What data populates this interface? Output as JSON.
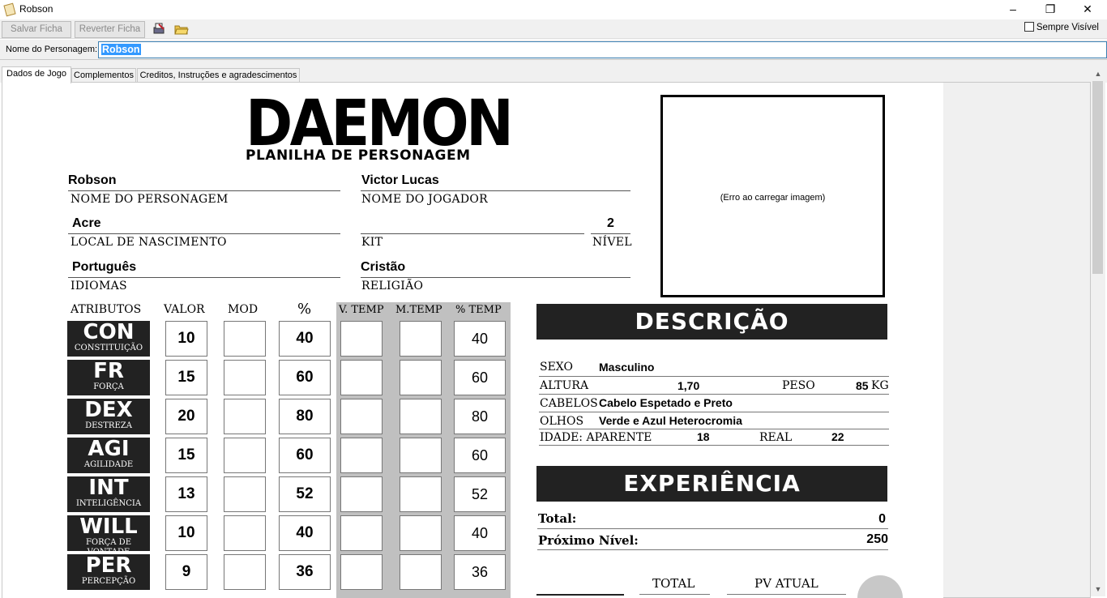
{
  "window": {
    "title": "Robson",
    "minimize": "–",
    "restore": "❐",
    "close": "✕"
  },
  "toolbar": {
    "save_label": "Salvar Ficha",
    "revert_label": "Reverter Ficha",
    "always_visible_label": "Sempre Visível"
  },
  "name_bar": {
    "label": "Nome do Personagem:",
    "value": "Robson"
  },
  "tabs": [
    {
      "label": "Dados de Jogo"
    },
    {
      "label": "Complementos"
    },
    {
      "label": "Creditos, Instruções e agradescimentos"
    }
  ],
  "sheet": {
    "logo": "DAEMON",
    "logo_sub": "PLANILHA DE PERSONAGEM",
    "character_name": {
      "value": "Robson",
      "label": "NOME DO PERSONAGEM"
    },
    "player_name": {
      "value": "Victor Lucas",
      "label": "NOME DO JOGADOR"
    },
    "birthplace": {
      "value": "Acre",
      "label": "LOCAL DE NASCIMENTO"
    },
    "kit": {
      "value": "",
      "label": "KIT"
    },
    "level": {
      "value": "2",
      "label": "NÍVEL"
    },
    "languages": {
      "value": "Português",
      "label": "IDIOMAS"
    },
    "religion": {
      "value": "Cristão",
      "label": "RELIGIÃO"
    },
    "image_error": "(Erro ao carregar imagem)",
    "attr_headers": {
      "attributes": "ATRIBUTOS",
      "value": "VALOR",
      "mod": "MOD",
      "percent": "%",
      "v_temp": "V. TEMP",
      "m_temp": "M.TEMP",
      "pct_temp": "% TEMP"
    },
    "attributes": [
      {
        "abbr": "CON",
        "name": "CONSTITUIÇÃO",
        "value": "10",
        "mod": "",
        "percent": "40",
        "v_temp": "",
        "m_temp": "",
        "pct_temp": "40"
      },
      {
        "abbr": "FR",
        "name": "FORÇA",
        "value": "15",
        "mod": "",
        "percent": "60",
        "v_temp": "",
        "m_temp": "",
        "pct_temp": "60"
      },
      {
        "abbr": "DEX",
        "name": "DESTREZA",
        "value": "20",
        "mod": "",
        "percent": "80",
        "v_temp": "",
        "m_temp": "",
        "pct_temp": "80"
      },
      {
        "abbr": "AGI",
        "name": "AGILIDADE",
        "value": "15",
        "mod": "",
        "percent": "60",
        "v_temp": "",
        "m_temp": "",
        "pct_temp": "60"
      },
      {
        "abbr": "INT",
        "name": "INTELIGÊNCIA",
        "value": "13",
        "mod": "",
        "percent": "52",
        "v_temp": "",
        "m_temp": "",
        "pct_temp": "52"
      },
      {
        "abbr": "WILL",
        "name": "FORÇA DE VONTADE",
        "value": "10",
        "mod": "",
        "percent": "40",
        "v_temp": "",
        "m_temp": "",
        "pct_temp": "40"
      },
      {
        "abbr": "PER",
        "name": "PERCEPÇÃO",
        "value": "9",
        "mod": "",
        "percent": "36",
        "v_temp": "",
        "m_temp": "",
        "pct_temp": "36"
      }
    ],
    "description": {
      "title": "DESCRIÇÃO",
      "sex_label": "SEXO",
      "sex": "Masculino",
      "height_label": "ALTURA",
      "height": "1,70",
      "weight_label": "PESO",
      "weight": "85",
      "weight_unit": "KG",
      "hair_label": "CABELOS",
      "hair": "Cabelo Espetado e Preto",
      "eyes_label": "OLHOS",
      "eyes": "Verde e Azul Heterocromia",
      "age_label": "IDADE: APARENTE",
      "age_apparent": "18",
      "real_label": "REAL",
      "age_real": "22"
    },
    "experience": {
      "title": "EXPERIÊNCIA",
      "total_label": "Total:",
      "total": "0",
      "next_label": "Próximo Nível:",
      "next": "250"
    },
    "hp": {
      "total_label": "TOTAL",
      "current_label": "PV ATUAL"
    }
  }
}
